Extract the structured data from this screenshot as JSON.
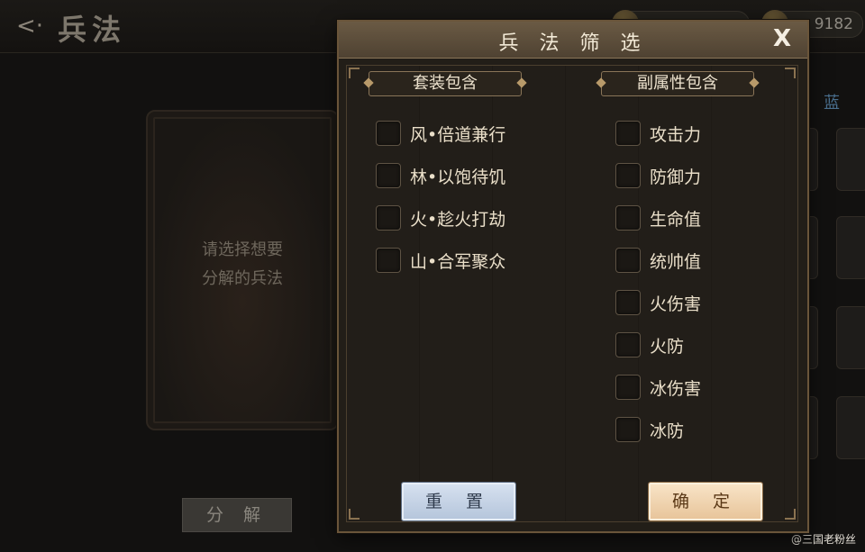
{
  "background": {
    "back_icon": "back-arrow-icon",
    "page_title": "兵法",
    "resource_b_value": "9182",
    "decompose_hint": "请选择想要\n分解的兵法",
    "decompose_button": "分 解",
    "side_tab_label": "蓝",
    "watermark": "@三国老粉丝"
  },
  "dialog": {
    "title": "兵 法 筛 选",
    "close_label": "X",
    "set_section": {
      "title": "套装包含",
      "options": [
        "风•倍道兼行",
        "林•以饱待饥",
        "火•趁火打劫",
        "山•合军聚众"
      ]
    },
    "attr_section": {
      "title": "副属性包含",
      "options": [
        "攻击力",
        "防御力",
        "生命值",
        "统帅值",
        "火伤害",
        "火防",
        "冰伤害",
        "冰防"
      ]
    },
    "reset_label": "重 置",
    "confirm_label": "确 定"
  },
  "colors": {
    "dialog_border": "#6a553a",
    "reset_button": "#c5d3e6",
    "confirm_button": "#f0d4b0"
  }
}
